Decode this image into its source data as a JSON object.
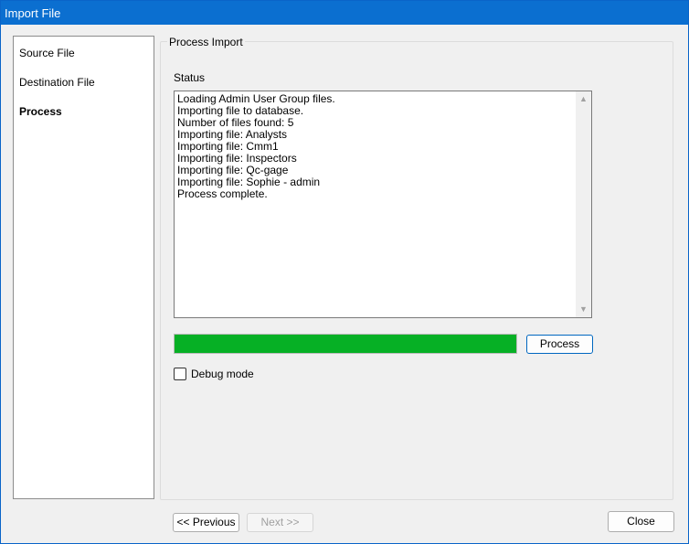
{
  "window": {
    "title": "Import File"
  },
  "sidebar": {
    "items": [
      {
        "label": "Source File",
        "active": false
      },
      {
        "label": "Destination File",
        "active": false
      },
      {
        "label": "Process",
        "active": true
      }
    ]
  },
  "main": {
    "group_title": "Process Import",
    "status_label": "Status",
    "status_lines": [
      "Loading Admin User Group files.",
      "Importing file to database.",
      "Number of files found: 5",
      "Importing file: Analysts",
      "Importing file: Cmm1",
      "Importing file: Inspectors",
      "Importing file: Qc-gage",
      "Importing file: Sophie - admin",
      "Process complete."
    ],
    "progress_fraction": 1.0,
    "progress_color": "#06b025",
    "process_button": "Process",
    "debug_mode_label": "Debug mode",
    "debug_mode_checked": false
  },
  "footer": {
    "previous_button": "<< Previous",
    "next_button": "Next >>",
    "close_button": "Close"
  }
}
